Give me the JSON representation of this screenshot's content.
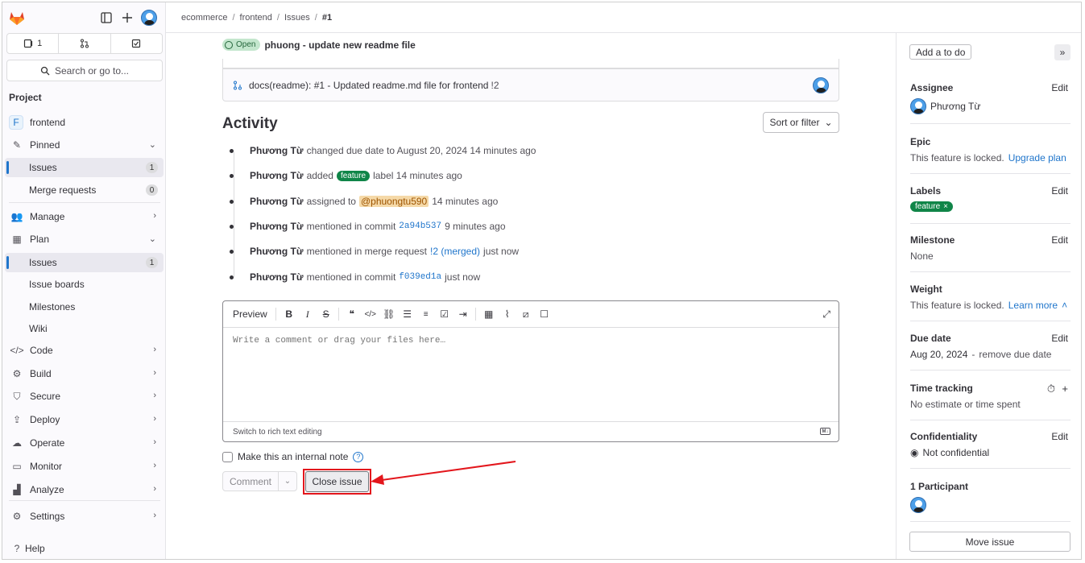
{
  "colors": {
    "accent": "#1f75cb",
    "label_green": "#108548",
    "annotation_red": "#e3161c",
    "open_badge_bg": "#c3e6cd"
  },
  "topbar": {
    "counts": {
      "issues": "1",
      "mrs": "",
      "todos": ""
    },
    "search_placeholder": "Search or go to..."
  },
  "breadcrumb": [
    "ecommerce",
    "frontend",
    "Issues",
    "#1"
  ],
  "sidebar": {
    "section": "Project",
    "project_name": "frontend",
    "project_initial": "F",
    "items": [
      {
        "label": "Pinned",
        "icon": "pin-icon"
      },
      {
        "label": "Issues",
        "count": "1"
      },
      {
        "label": "Merge requests",
        "count": "0"
      },
      {
        "label": "Manage",
        "icon": "users-icon"
      },
      {
        "label": "Plan",
        "icon": "calendar-icon"
      },
      {
        "label": "Issues",
        "count": "1"
      },
      {
        "label": "Issue boards"
      },
      {
        "label": "Milestones"
      },
      {
        "label": "Wiki"
      },
      {
        "label": "Code",
        "icon": "code-icon"
      },
      {
        "label": "Build",
        "icon": "rocket-icon"
      },
      {
        "label": "Secure",
        "icon": "shield-icon"
      },
      {
        "label": "Deploy",
        "icon": "deploy-icon"
      },
      {
        "label": "Operate",
        "icon": "cloud-icon"
      },
      {
        "label": "Monitor",
        "icon": "monitor-icon"
      },
      {
        "label": "Analyze",
        "icon": "chart-icon"
      },
      {
        "label": "Settings",
        "icon": "gear-icon"
      },
      {
        "label": "Help",
        "icon": "help-icon"
      }
    ]
  },
  "issue": {
    "status": "Open",
    "title": "phuong - update new readme file",
    "related_mr": {
      "title": "docs(readme): #1 - Updated readme.md file for frontend",
      "ref": "!2"
    }
  },
  "activity": {
    "heading": "Activity",
    "sort_label": "Sort or filter",
    "items": [
      {
        "author": "Phương Từ",
        "text": "changed due date to August 20, 2024 14 minutes ago"
      },
      {
        "author": "Phương Từ",
        "pre": "added",
        "label": "feature",
        "post": "label 14 minutes ago"
      },
      {
        "author": "Phương Từ",
        "pre": "assigned to",
        "mention": "@phuongtu590",
        "post": "14 minutes ago"
      },
      {
        "author": "Phương Từ",
        "pre": "mentioned in commit",
        "commit": "2a94b537",
        "post": "9 minutes ago"
      },
      {
        "author": "Phương Từ",
        "pre": "mentioned in merge request",
        "link": "!2 (merged)",
        "post": "just now"
      },
      {
        "author": "Phương Từ",
        "pre": "mentioned in commit",
        "commit": "f039ed1a",
        "post": "just now"
      }
    ]
  },
  "editor": {
    "tab": "Preview",
    "placeholder": "Write a comment or drag your files here…",
    "footer": "Switch to rich text editing",
    "internal_note": "Make this an internal note"
  },
  "actions": {
    "comment": "Comment",
    "close_issue": "Close issue"
  },
  "right_sidebar": {
    "todo": "Add a to do",
    "assignee": {
      "title": "Assignee",
      "edit": "Edit",
      "value": "Phương Từ"
    },
    "epic": {
      "title": "Epic",
      "value": "This feature is locked.",
      "link": "Upgrade plan"
    },
    "labels": {
      "title": "Labels",
      "edit": "Edit",
      "value": "feature"
    },
    "milestone": {
      "title": "Milestone",
      "edit": "Edit",
      "value": "None"
    },
    "weight": {
      "title": "Weight",
      "value": "This feature is locked.",
      "link": "Learn more"
    },
    "due_date": {
      "title": "Due date",
      "edit": "Edit",
      "value": "Aug 20, 2024",
      "remove": "remove due date"
    },
    "time_tracking": {
      "title": "Time tracking",
      "value": "No estimate or time spent"
    },
    "confidentiality": {
      "title": "Confidentiality",
      "edit": "Edit",
      "value": "Not confidential"
    },
    "participants": {
      "title": "1 Participant"
    },
    "move": "Move issue"
  }
}
